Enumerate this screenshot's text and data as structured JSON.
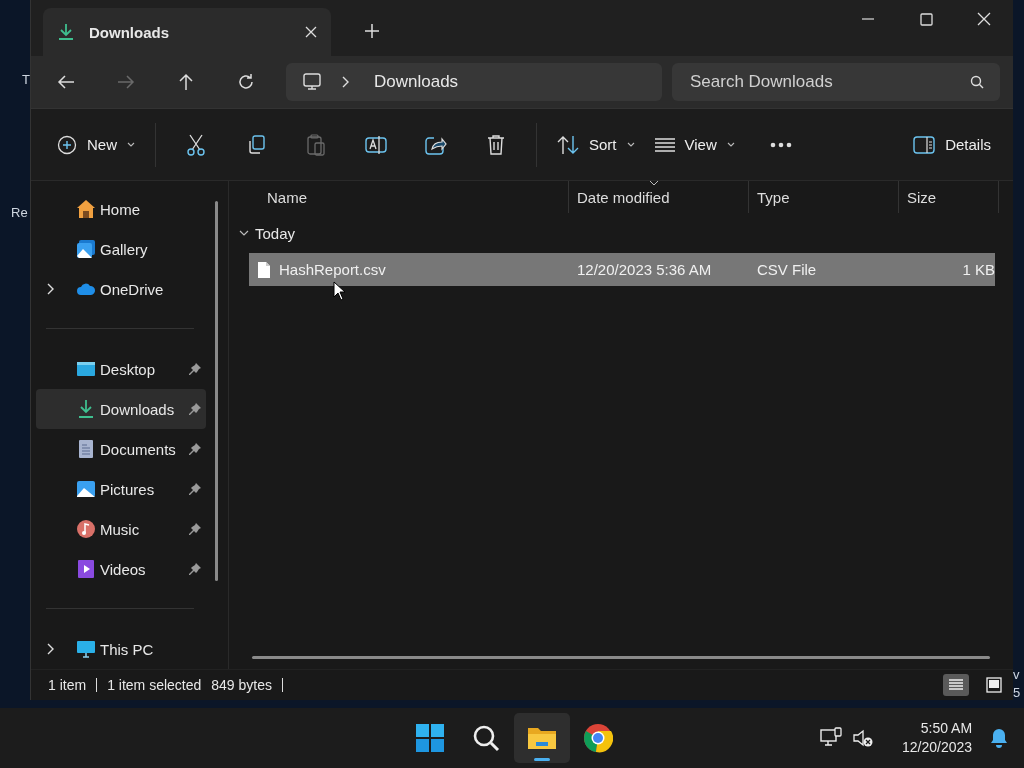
{
  "desktop": {
    "left_labels": [
      "T",
      "Re"
    ],
    "right_labels": [
      "v",
      "5"
    ]
  },
  "window": {
    "tabs": [
      {
        "label": "Downloads",
        "selected": true
      }
    ]
  },
  "nav": {
    "back_disabled": false,
    "forward_disabled": true,
    "up_disabled": false
  },
  "address": {
    "path": [
      "Downloads"
    ]
  },
  "search": {
    "placeholder": "Search Downloads"
  },
  "toolbar": {
    "new_label": "New",
    "paste_disabled": true,
    "sort_label": "Sort",
    "view_label": "View",
    "details_label": "Details"
  },
  "sidebar": {
    "groups": [
      {
        "items": [
          {
            "kind": "home",
            "label": "Home",
            "expandable": false,
            "pinned": false,
            "selected": false
          },
          {
            "kind": "gallery",
            "label": "Gallery",
            "expandable": false,
            "pinned": false,
            "selected": false
          },
          {
            "kind": "cloud",
            "label": "OneDrive",
            "expandable": true,
            "pinned": false,
            "selected": false
          }
        ]
      },
      {
        "items": [
          {
            "kind": "desktop",
            "label": "Desktop",
            "expandable": false,
            "pinned": true,
            "selected": false
          },
          {
            "kind": "download",
            "label": "Downloads",
            "expandable": false,
            "pinned": true,
            "selected": true
          },
          {
            "kind": "document",
            "label": "Documents",
            "expandable": false,
            "pinned": true,
            "selected": false
          },
          {
            "kind": "pictures",
            "label": "Pictures",
            "expandable": false,
            "pinned": true,
            "selected": false
          },
          {
            "kind": "music",
            "label": "Music",
            "expandable": false,
            "pinned": true,
            "selected": false
          },
          {
            "kind": "video",
            "label": "Videos",
            "expandable": false,
            "pinned": true,
            "selected": false
          }
        ]
      },
      {
        "items": [
          {
            "kind": "pc",
            "label": "This PC",
            "expandable": true,
            "pinned": false,
            "selected": false
          }
        ]
      }
    ]
  },
  "table": {
    "columns": [
      {
        "label": "Name",
        "sorted": false
      },
      {
        "label": "Date modified",
        "sorted": true
      },
      {
        "label": "Type",
        "sorted": false
      },
      {
        "label": "Size",
        "sorted": false
      }
    ],
    "groups": [
      {
        "label": "Today",
        "expanded": true,
        "rows": [
          {
            "name": "HashReport.csv",
            "date": "12/20/2023 5:36 AM",
            "type": "CSV File",
            "size": "1 KB",
            "selected": true
          }
        ]
      }
    ]
  },
  "status_bar": {
    "items": [
      "1 item",
      "1 item selected",
      "849 bytes"
    ],
    "views": [
      {
        "kind": "details",
        "selected": true
      },
      {
        "kind": "tiles",
        "selected": false
      }
    ]
  },
  "taskbar": {
    "apps": [
      {
        "kind": "start",
        "active": false
      },
      {
        "kind": "search",
        "active": false
      },
      {
        "kind": "explorer",
        "active": true
      },
      {
        "kind": "browser",
        "active": false
      }
    ],
    "time": "5:50 AM",
    "date": "12/20/2023"
  }
}
